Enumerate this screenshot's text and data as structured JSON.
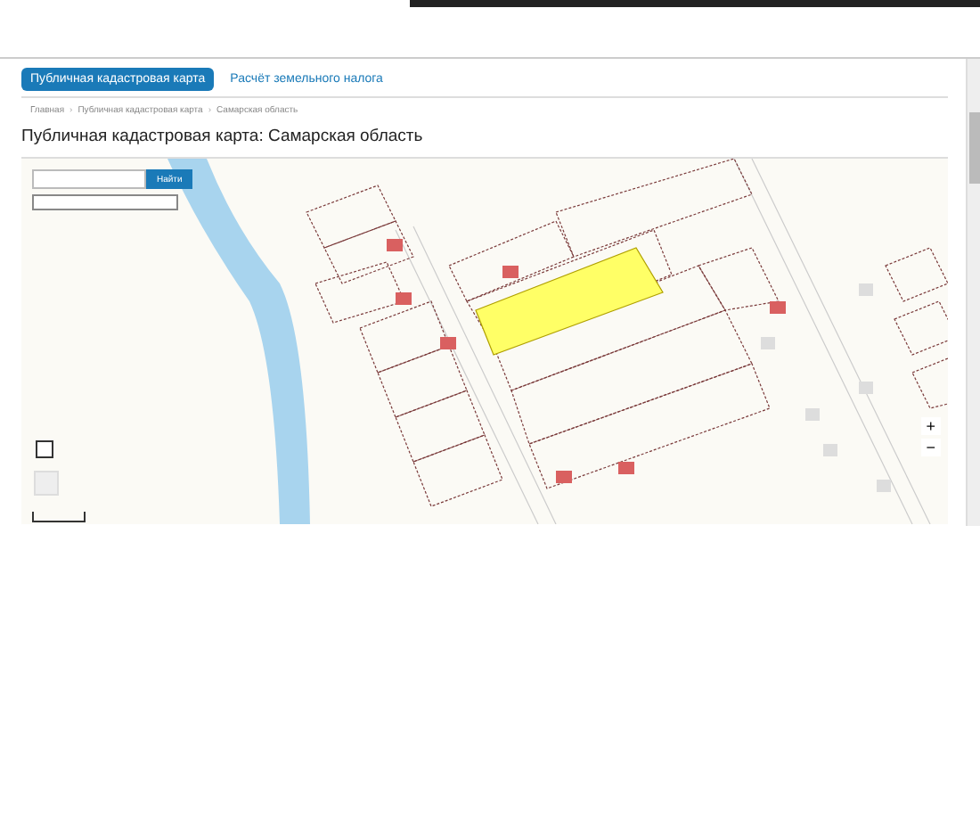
{
  "tabs": [
    {
      "label": "Публичная кадастровая карта",
      "selected": true
    },
    {
      "label": "Расчёт земельного налога",
      "selected": false
    }
  ],
  "breadcrumbs": [
    {
      "label": "Главная"
    },
    {
      "separator": "›",
      "label": "Публичная кадастровая карта"
    },
    {
      "separator": "›",
      "label": "Самарская область"
    }
  ],
  "title": "Публичная кадастровая карта: Самарская область",
  "map": {
    "search_button": "Найти",
    "zoom_in": "+",
    "zoom_out": "−"
  }
}
